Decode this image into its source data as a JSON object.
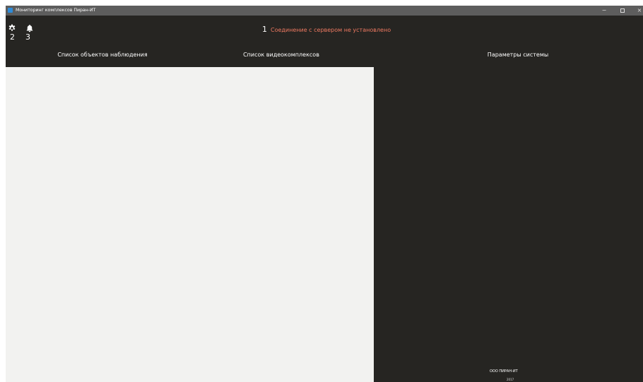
{
  "window": {
    "title": "Мониторинг комплексов Пиран-ИТ",
    "minimize": "−",
    "close": "×"
  },
  "header": {
    "settings_badge": "2",
    "notifications_badge": "3",
    "connection_count": "1",
    "connection_status": "Соединение с сервером не установлено",
    "icons": {
      "settings": "gear-icon",
      "notifications": "bell-icon"
    }
  },
  "tabs": [
    {
      "label": "Список объектов наблюдения"
    },
    {
      "label": "Список видеокомплексов"
    },
    {
      "label": "Параметры системы"
    }
  ],
  "footer": {
    "company": "ООО ПИРАН-ИТ",
    "year": "2017"
  },
  "colors": {
    "titlebar": "#5d5d5d",
    "dark_bg": "#262522",
    "light_panel": "#f2f2f0",
    "status_error": "#ee7961",
    "app_icon": "#2e8bd8"
  }
}
